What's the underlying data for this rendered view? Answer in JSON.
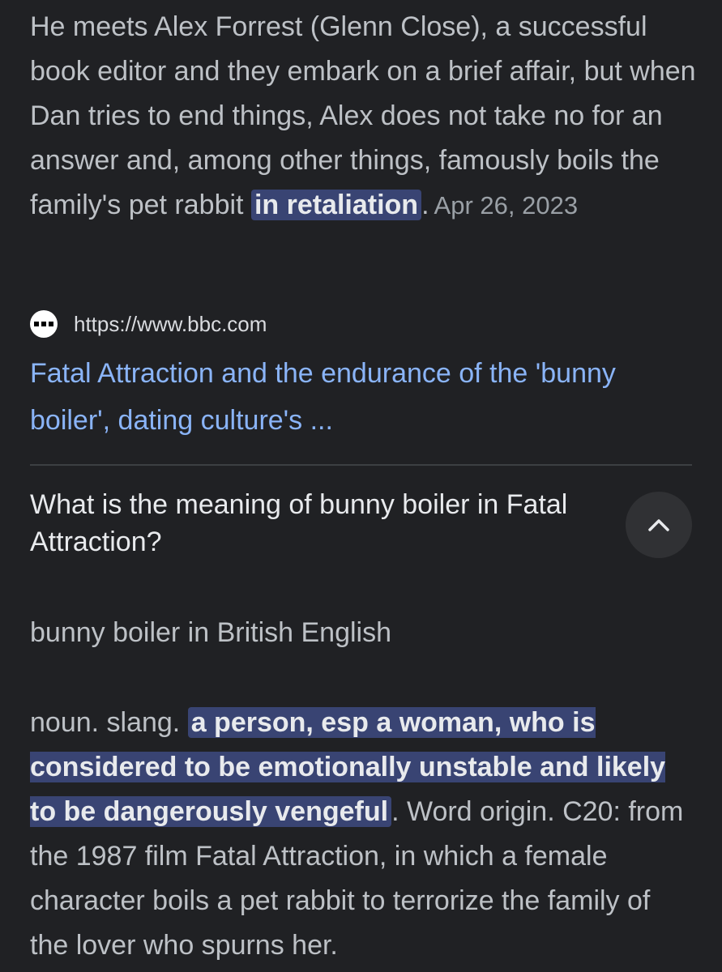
{
  "snippet": {
    "text_before": "He meets Alex Forrest (Glenn Close), a successful book editor and they embark on a brief affair, but when Dan tries to end things, Alex does not take no for an answer and, among other things, famously boils the family's pet rabbit ",
    "highlight": "in retaliation",
    "text_after": ".",
    "date": "Apr 26, 2023"
  },
  "source": {
    "favicon": "bbc-dots-icon",
    "url": "https://www.bbc.com"
  },
  "result": {
    "title": "Fatal Attraction and the endurance of the 'bunny boiler', dating culture's ..."
  },
  "question": {
    "text": "What is the meaning of bunny boiler in Fatal Attraction?",
    "toggle_icon": "chevron-up-icon"
  },
  "answer": {
    "heading": "bunny boiler in British English",
    "prefix": "noun. slang. ",
    "highlight": "a person, esp a woman, who is considered to be emotionally unstable and likely to be dangerously vengeful",
    "suffix": ". Word origin. C20: from the 1987 film Fatal Attraction, in which a female character boils a pet rabbit to terrorize the family of the lover who spurns her."
  },
  "colors": {
    "background": "#202124",
    "link": "#8ab4f8",
    "highlight_bg": "#394473",
    "text": "#bdc1c6"
  }
}
